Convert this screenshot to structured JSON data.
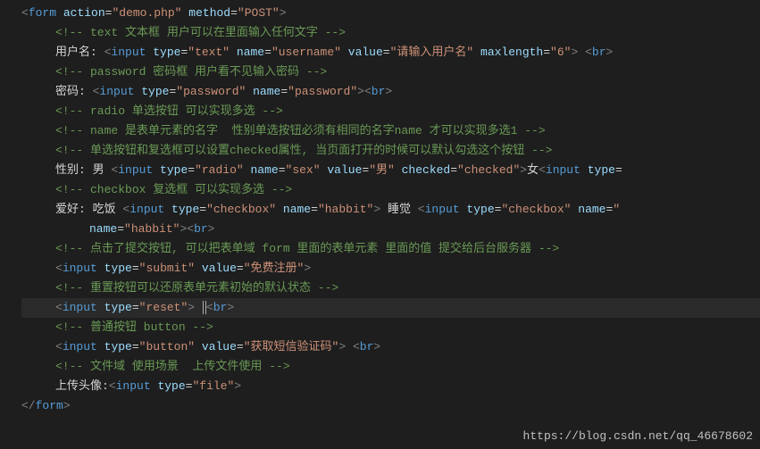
{
  "watermark": "https://blog.csdn.net/qq_46678602",
  "lines": [
    {
      "indent": 0,
      "active": false,
      "tokens": [
        [
          "br",
          "<"
        ],
        [
          "tag",
          "form"
        ],
        [
          "txt",
          " "
        ],
        [
          "attr",
          "action"
        ],
        [
          "eq",
          "="
        ],
        [
          "str",
          "\"demo.php\""
        ],
        [
          "txt",
          " "
        ],
        [
          "attr",
          "method"
        ],
        [
          "eq",
          "="
        ],
        [
          "str",
          "\"POST\""
        ],
        [
          "br",
          ">"
        ]
      ]
    },
    {
      "indent": 1,
      "active": false,
      "tokens": [
        [
          "cmt",
          "<!-- text 文本框 用户可以在里面输入任何文字 -->"
        ]
      ]
    },
    {
      "indent": 1,
      "active": false,
      "tokens": [
        [
          "txt",
          "用户名: "
        ],
        [
          "br",
          "<"
        ],
        [
          "tag",
          "input"
        ],
        [
          "txt",
          " "
        ],
        [
          "attr",
          "type"
        ],
        [
          "eq",
          "="
        ],
        [
          "str",
          "\"text\""
        ],
        [
          "txt",
          " "
        ],
        [
          "attr",
          "name"
        ],
        [
          "eq",
          "="
        ],
        [
          "str",
          "\"username\""
        ],
        [
          "txt",
          " "
        ],
        [
          "attr",
          "value"
        ],
        [
          "eq",
          "="
        ],
        [
          "str",
          "\"请输入用户名\""
        ],
        [
          "txt",
          " "
        ],
        [
          "attr",
          "maxlength"
        ],
        [
          "eq",
          "="
        ],
        [
          "str",
          "\"6\""
        ],
        [
          "br",
          ">"
        ],
        [
          "txt",
          " "
        ],
        [
          "br",
          "<"
        ],
        [
          "tag",
          "br"
        ],
        [
          "br",
          ">"
        ]
      ]
    },
    {
      "indent": 1,
      "active": false,
      "tokens": [
        [
          "cmt",
          "<!-- password 密码框 用户看不见输入密码 -->"
        ]
      ]
    },
    {
      "indent": 1,
      "active": false,
      "tokens": [
        [
          "txt",
          "密码: "
        ],
        [
          "br",
          "<"
        ],
        [
          "tag",
          "input"
        ],
        [
          "txt",
          " "
        ],
        [
          "attr",
          "type"
        ],
        [
          "eq",
          "="
        ],
        [
          "str",
          "\"password\""
        ],
        [
          "txt",
          " "
        ],
        [
          "attr",
          "name"
        ],
        [
          "eq",
          "="
        ],
        [
          "str",
          "\"password\""
        ],
        [
          "br",
          "><"
        ],
        [
          "tag",
          "br"
        ],
        [
          "br",
          ">"
        ]
      ]
    },
    {
      "indent": 1,
      "active": false,
      "tokens": [
        [
          "cmt",
          "<!-- radio 单选按钮 可以实现多选 -->"
        ]
      ]
    },
    {
      "indent": 1,
      "active": false,
      "tokens": [
        [
          "cmt",
          "<!-- name 是表单元素的名字  性别单选按钮必须有相同的名字name 才可以实现多选1 -->"
        ]
      ]
    },
    {
      "indent": 1,
      "active": false,
      "tokens": [
        [
          "cmt",
          "<!-- 单选按钮和复选框可以设置checked属性, 当页面打开的时候可以默认勾选这个按钮 -->"
        ]
      ]
    },
    {
      "indent": 1,
      "active": false,
      "tokens": [
        [
          "txt",
          "性别: 男 "
        ],
        [
          "br",
          "<"
        ],
        [
          "tag",
          "input"
        ],
        [
          "txt",
          " "
        ],
        [
          "attr",
          "type"
        ],
        [
          "eq",
          "="
        ],
        [
          "str",
          "\"radio\""
        ],
        [
          "txt",
          " "
        ],
        [
          "attr",
          "name"
        ],
        [
          "eq",
          "="
        ],
        [
          "str",
          "\"sex\""
        ],
        [
          "txt",
          " "
        ],
        [
          "attr",
          "value"
        ],
        [
          "eq",
          "="
        ],
        [
          "str",
          "\"男\""
        ],
        [
          "txt",
          " "
        ],
        [
          "attr",
          "checked"
        ],
        [
          "eq",
          "="
        ],
        [
          "str",
          "\"checked\""
        ],
        [
          "br",
          ">"
        ],
        [
          "txt",
          "女"
        ],
        [
          "br",
          "<"
        ],
        [
          "tag",
          "input"
        ],
        [
          "txt",
          " "
        ],
        [
          "attr",
          "type"
        ],
        [
          "eq",
          "="
        ]
      ]
    },
    {
      "indent": 1,
      "active": false,
      "tokens": [
        [
          "cmt",
          "<!-- checkbox 复选框 可以实现多选 -->"
        ]
      ]
    },
    {
      "indent": 1,
      "active": false,
      "tokens": [
        [
          "txt",
          "爱好: 吃饭 "
        ],
        [
          "br",
          "<"
        ],
        [
          "tag",
          "input"
        ],
        [
          "txt",
          " "
        ],
        [
          "attr",
          "type"
        ],
        [
          "eq",
          "="
        ],
        [
          "str",
          "\"checkbox\""
        ],
        [
          "txt",
          " "
        ],
        [
          "attr",
          "name"
        ],
        [
          "eq",
          "="
        ],
        [
          "str",
          "\"habbit\""
        ],
        [
          "br",
          ">"
        ],
        [
          "txt",
          " 睡觉 "
        ],
        [
          "br",
          "<"
        ],
        [
          "tag",
          "input"
        ],
        [
          "txt",
          " "
        ],
        [
          "attr",
          "type"
        ],
        [
          "eq",
          "="
        ],
        [
          "str",
          "\"checkbox\""
        ],
        [
          "txt",
          " "
        ],
        [
          "attr",
          "name"
        ],
        [
          "eq",
          "="
        ],
        [
          "str",
          "\""
        ]
      ]
    },
    {
      "indent": 2,
      "active": false,
      "tokens": [
        [
          "attr",
          "name"
        ],
        [
          "eq",
          "="
        ],
        [
          "str",
          "\"habbit\""
        ],
        [
          "br",
          "><"
        ],
        [
          "tag",
          "br"
        ],
        [
          "br",
          ">"
        ]
      ]
    },
    {
      "indent": 1,
      "active": false,
      "tokens": [
        [
          "cmt",
          "<!-- 点击了提交按钮, 可以把表单域 form 里面的表单元素 里面的值 提交给后台服务器 -->"
        ]
      ]
    },
    {
      "indent": 1,
      "active": false,
      "tokens": [
        [
          "br",
          "<"
        ],
        [
          "tag",
          "input"
        ],
        [
          "txt",
          " "
        ],
        [
          "attr",
          "type"
        ],
        [
          "eq",
          "="
        ],
        [
          "str",
          "\"submit\""
        ],
        [
          "txt",
          " "
        ],
        [
          "attr",
          "value"
        ],
        [
          "eq",
          "="
        ],
        [
          "str",
          "\"免费注册\""
        ],
        [
          "br",
          ">"
        ]
      ]
    },
    {
      "indent": 1,
      "active": false,
      "tokens": [
        [
          "cmt",
          "<!-- 重置按钮可以还原表单元素初始的默认状态 -->"
        ]
      ]
    },
    {
      "indent": 1,
      "active": true,
      "tokens": [
        [
          "br",
          "<"
        ],
        [
          "tag",
          "input"
        ],
        [
          "txt",
          " "
        ],
        [
          "attr",
          "type"
        ],
        [
          "eq",
          "="
        ],
        [
          "str",
          "\"reset\""
        ],
        [
          "br",
          ">"
        ],
        [
          "txt",
          " "
        ],
        [
          "cursor",
          ""
        ],
        [
          "br",
          "<"
        ],
        [
          "tag",
          "br"
        ],
        [
          "br",
          ">"
        ]
      ]
    },
    {
      "indent": 1,
      "active": false,
      "tokens": [
        [
          "cmt",
          "<!-- 普通按钮 button -->"
        ]
      ]
    },
    {
      "indent": 1,
      "active": false,
      "tokens": [
        [
          "br",
          "<"
        ],
        [
          "tag",
          "input"
        ],
        [
          "txt",
          " "
        ],
        [
          "attr",
          "type"
        ],
        [
          "eq",
          "="
        ],
        [
          "str",
          "\"button\""
        ],
        [
          "txt",
          " "
        ],
        [
          "attr",
          "value"
        ],
        [
          "eq",
          "="
        ],
        [
          "str",
          "\"获取短信验证码\""
        ],
        [
          "br",
          ">"
        ],
        [
          "txt",
          " "
        ],
        [
          "br",
          "<"
        ],
        [
          "tag",
          "br"
        ],
        [
          "br",
          ">"
        ]
      ]
    },
    {
      "indent": 1,
      "active": false,
      "tokens": [
        [
          "cmt",
          "<!-- 文件域 使用场景  上传文件使用 -->"
        ]
      ]
    },
    {
      "indent": 1,
      "active": false,
      "tokens": [
        [
          "txt",
          "上传头像:"
        ],
        [
          "br",
          "<"
        ],
        [
          "tag",
          "input"
        ],
        [
          "txt",
          " "
        ],
        [
          "attr",
          "type"
        ],
        [
          "eq",
          "="
        ],
        [
          "str",
          "\"file\""
        ],
        [
          "br",
          ">"
        ]
      ]
    },
    {
      "indent": 0,
      "active": false,
      "tokens": [
        [
          "br",
          "</"
        ],
        [
          "tag",
          "form"
        ],
        [
          "br",
          ">"
        ]
      ]
    }
  ]
}
